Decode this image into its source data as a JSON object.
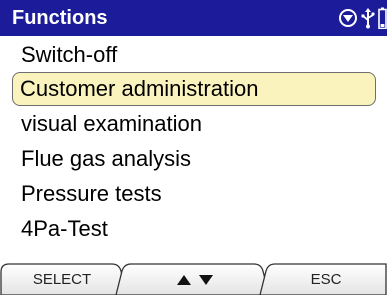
{
  "header": {
    "title": "Functions",
    "icons": [
      "navigation-down-icon",
      "usb-icon",
      "battery-icon"
    ],
    "background_color": "#1c1c9a",
    "text_color": "#ffffff"
  },
  "menu": {
    "items": [
      {
        "label": "Switch-off"
      },
      {
        "label": "Customer administration",
        "selected": true
      },
      {
        "label": "visual examination"
      },
      {
        "label": "Flue gas analysis"
      },
      {
        "label": "Pressure tests"
      },
      {
        "label": "4Pa-Test"
      }
    ],
    "selected_color": "#fbf3bd"
  },
  "softkeys": {
    "left_label": "SELECT",
    "middle_icons": [
      "arrow-up-icon",
      "arrow-down-icon"
    ],
    "right_label": "ESC"
  }
}
